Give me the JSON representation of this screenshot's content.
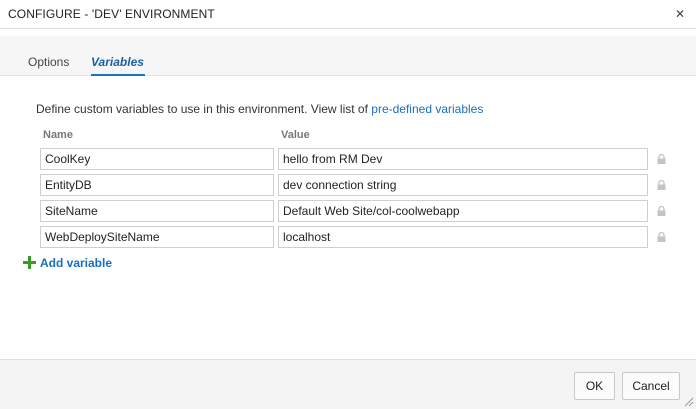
{
  "dialog": {
    "title": "CONFIGURE - 'DEV' ENVIRONMENT",
    "close_icon": "close-icon"
  },
  "tabs": [
    {
      "label": "Options",
      "selected": false
    },
    {
      "label": "Variables",
      "selected": true
    }
  ],
  "description": {
    "text": "Define custom variables to use in this environment. View list of ",
    "link": "pre-defined variables"
  },
  "table": {
    "headers": {
      "name": "Name",
      "value": "Value"
    },
    "rows": [
      {
        "name": "CoolKey",
        "value": "hello from RM Dev"
      },
      {
        "name": "EntityDB",
        "value": "dev connection string"
      },
      {
        "name": "SiteName",
        "value": "Default Web Site/col-coolwebapp"
      },
      {
        "name": "WebDeploySiteName",
        "value": "localhost"
      }
    ]
  },
  "add_variable_label": "Add variable",
  "footer": {
    "ok_label": "OK",
    "cancel_label": "Cancel"
  },
  "colors": {
    "accent": "#1a6fc0",
    "add_icon": "#3a9a2a"
  }
}
